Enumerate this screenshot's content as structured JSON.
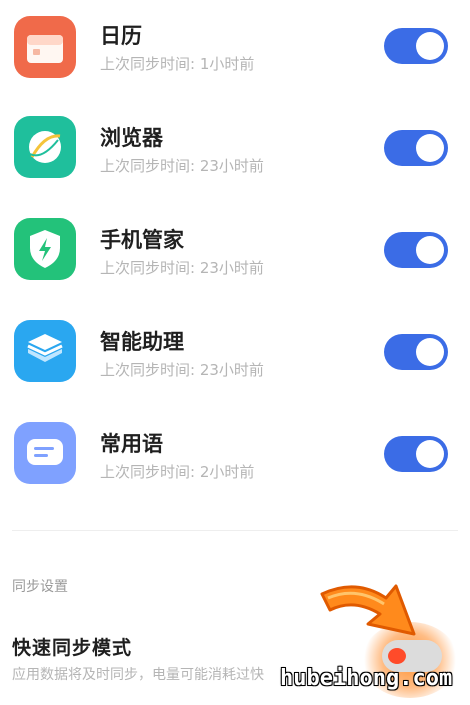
{
  "apps": [
    {
      "name": "日历",
      "status": "上次同步时间: 1小时前",
      "enabled": true,
      "icon": "calendar-icon"
    },
    {
      "name": "浏览器",
      "status": "上次同步时间: 23小时前",
      "enabled": true,
      "icon": "browser-icon"
    },
    {
      "name": "手机管家",
      "status": "上次同步时间: 23小时前",
      "enabled": true,
      "icon": "shield-icon"
    },
    {
      "name": "智能助理",
      "status": "上次同步时间: 23小时前",
      "enabled": true,
      "icon": "layers-icon"
    },
    {
      "name": "常用语",
      "status": "上次同步时间: 2小时前",
      "enabled": true,
      "icon": "message-icon"
    }
  ],
  "sync_settings": {
    "section_label": "同步设置",
    "fast_sync": {
      "title": "快速同步模式",
      "description": "应用数据将及时同步，电量可能消耗过快",
      "enabled": false
    }
  },
  "watermark": "hubeihong.com",
  "colors": {
    "toggle_on": "#3b6ce6",
    "calendar": "#f06a4a",
    "browser": "#1fbf9c",
    "security": "#23c27a",
    "assistant": "#2aa7f0",
    "phrases": "#7fa1ff",
    "arrow": "#ff8a1c"
  }
}
